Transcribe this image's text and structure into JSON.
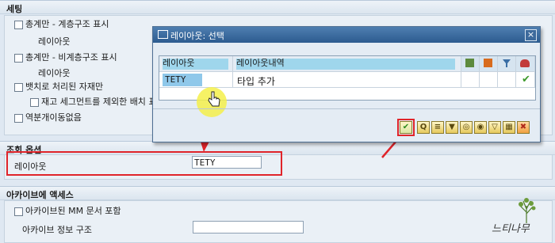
{
  "settings": {
    "title": "세팅",
    "items": [
      {
        "label": "총계만 - 계층구조 표시",
        "sub": "레이아웃"
      },
      {
        "label": "총계만 - 비계층구조 표시",
        "sub": "레이아웃"
      },
      {
        "label": "뱃치로 처리된 자재만"
      },
      {
        "label": "재고 세그먼트를 제외한 배치 표"
      },
      {
        "label": "역분개이동없음"
      }
    ]
  },
  "query_options": {
    "title": "조회 옵션",
    "layout_label": "레이아웃",
    "layout_value": "TETY"
  },
  "archive": {
    "title": "아카이브에 액세스",
    "checkbox_label": "아카이브된 MM 문서 포함",
    "info_label": "아카이브 정보 구조",
    "info_value": ""
  },
  "dialog": {
    "title": "레이아웃: 선택",
    "columns": [
      "레이아웃",
      "레이아웃내역"
    ],
    "rows": [
      {
        "layout": "TETY",
        "description": "타입 추가"
      }
    ],
    "toolbar_icons": [
      "confirm-icon",
      "search-icon",
      "print-icon",
      "filter-icon",
      "find-icon",
      "find-next-icon",
      "filter-settings-icon",
      "table-icon",
      "cancel-icon"
    ]
  },
  "watermark": "느티나무",
  "colors": {
    "accent": "#e0242a",
    "title_bar": "#2c5b8f",
    "highlight": "#f5f04a",
    "header": "#d6e4f0"
  }
}
